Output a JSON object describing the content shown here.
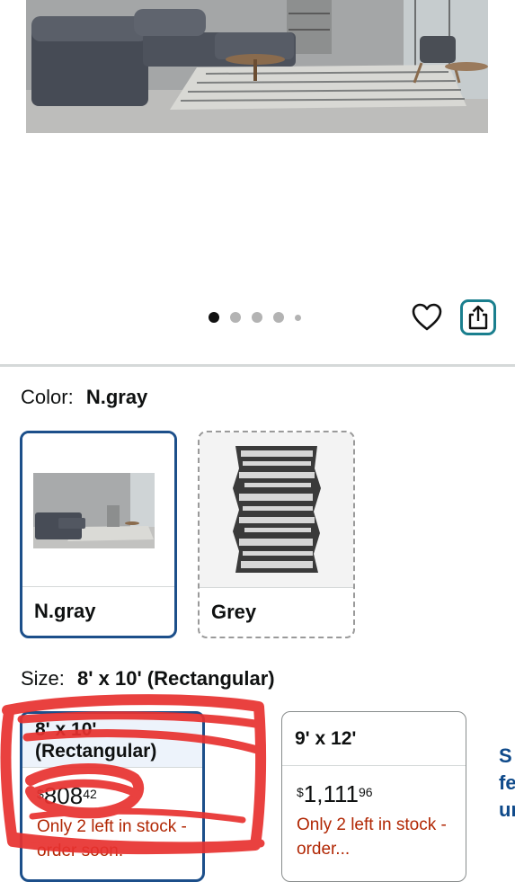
{
  "color_section": {
    "label": "Color:",
    "selected": "N.gray"
  },
  "color_options": [
    {
      "name": "N.gray",
      "selected": true
    },
    {
      "name": "Grey",
      "selected": false
    }
  ],
  "carousel": {
    "count": 5,
    "active_index": 0
  },
  "size_section": {
    "label": "Size:",
    "selected": "8' x 10' (Rectangular)"
  },
  "size_options": [
    {
      "label": "8' x 10' (Rectangular)",
      "currency": "$",
      "price_main": "808",
      "price_cents": "42",
      "stock": "Only 2 left in stock - order soon.",
      "selected": true
    },
    {
      "label": "9' x 12'",
      "currency": "$",
      "price_main": "1,111",
      "price_cents": "96",
      "stock": "Only 2 left in stock - order...",
      "selected": false
    }
  ],
  "icons": {
    "wishlist": "heart-icon",
    "share": "share-icon"
  },
  "colors": {
    "selected_border": "#1c4f8a",
    "stock_text": "#b12704",
    "share_accent": "#1a7f8e",
    "annotation_marker": "#e8312f"
  }
}
